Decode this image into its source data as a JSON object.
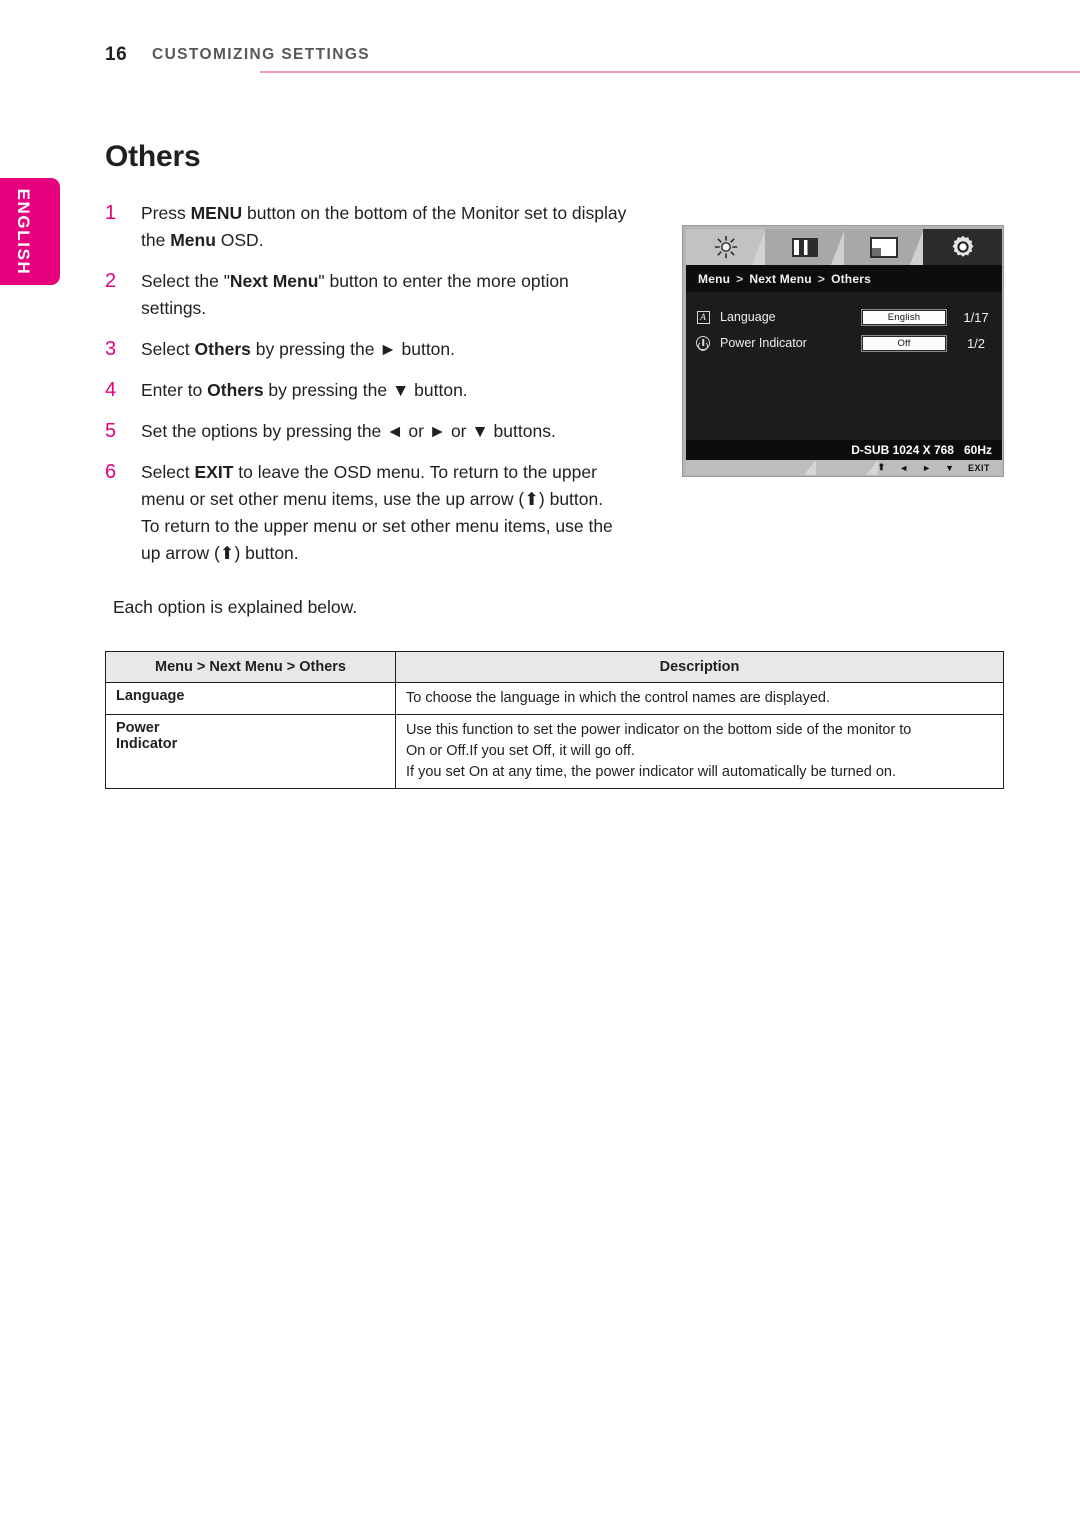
{
  "header": {
    "page_number": "16",
    "title": "CUSTOMIZING SETTINGS",
    "rule_color": "#f49ac1"
  },
  "side_tab": {
    "label": "ENGLISH",
    "color": "#e6007e"
  },
  "section": {
    "heading": "Others",
    "closing_note": "Each option is explained below."
  },
  "steps": [
    {
      "number": "1",
      "parts": [
        {
          "text": "Press ",
          "bold": false
        },
        {
          "text": "MENU",
          "bold": true
        },
        {
          "text": " button on the bottom of the Monitor set to display the ",
          "bold": false
        },
        {
          "text": "Menu",
          "bold": true
        },
        {
          "text": " OSD.",
          "bold": false
        }
      ]
    },
    {
      "number": "2",
      "parts": [
        {
          "text": "Select the \"",
          "bold": false
        },
        {
          "text": "Next Menu",
          "bold": true
        },
        {
          "text": "\" button to enter the more option settings.",
          "bold": false
        }
      ]
    },
    {
      "number": "3",
      "parts": [
        {
          "text": "Select ",
          "bold": false
        },
        {
          "text": "Others",
          "bold": true
        },
        {
          "text": " by pressing the ► button.",
          "bold": false
        }
      ]
    },
    {
      "number": "4",
      "parts": [
        {
          "text": "Enter to ",
          "bold": false
        },
        {
          "text": "Others",
          "bold": true
        },
        {
          "text": " by pressing the ▼ button.",
          "bold": false
        }
      ]
    },
    {
      "number": "5",
      "parts": [
        {
          "text": "Set the options by pressing the ◄ or ► or ▼ buttons.",
          "bold": false
        }
      ]
    },
    {
      "number": "6",
      "parts": [
        {
          "text": "Select ",
          "bold": false
        },
        {
          "text": "EXIT",
          "bold": true
        },
        {
          "text": " to leave the OSD menu.",
          "bold": false
        },
        {
          "text": "\nTo return to the upper menu or set other menu items, use the up arrow (⬆) button.",
          "bold": false
        }
      ]
    }
  ],
  "osd": {
    "tabs": [
      {
        "icon": "brightness-icon",
        "state": "light"
      },
      {
        "icon": "contrast-icon",
        "state": "normal"
      },
      {
        "icon": "screen-position-icon",
        "state": "normal"
      },
      {
        "icon": "gear-icon",
        "state": "active"
      }
    ],
    "breadcrumb": {
      "root": "Menu",
      "sep1": ">",
      "middle": "Next Menu",
      "sep2": ">",
      "leaf": "Others"
    },
    "rows": [
      {
        "icon": "language-a-icon",
        "label": "Language",
        "value": "English",
        "count": "1/17"
      },
      {
        "icon": "power-indicator-icon",
        "label": "Power Indicator",
        "value": "Off",
        "count": "1/2"
      }
    ],
    "status": {
      "resolution": "D-SUB 1024 X 768",
      "refresh": "60Hz"
    },
    "buttons": [
      {
        "name": "return-up-arrow",
        "glyph": "⬆"
      },
      {
        "name": "left-arrow",
        "glyph": "◄"
      },
      {
        "name": "right-arrow",
        "glyph": "►"
      },
      {
        "name": "down-arrow",
        "glyph": "▼"
      },
      {
        "name": "exit",
        "glyph": "EXIT"
      }
    ]
  },
  "table": {
    "headers": {
      "col1": "Menu > Next Menu > Others",
      "col2": "Description"
    },
    "rows": [
      {
        "name": "Language",
        "name_line2": "",
        "description_lines": [
          "To choose the language in which the control names are displayed."
        ]
      },
      {
        "name": "Power",
        "name_line2": "Indicator",
        "description_lines": [
          "Use this function to set the power indicator on the bottom side of the monitor to",
          "On or Off.If you set Off, it will go off.",
          "If you set On at any time, the power indicator will automatically be turned on."
        ]
      }
    ]
  }
}
